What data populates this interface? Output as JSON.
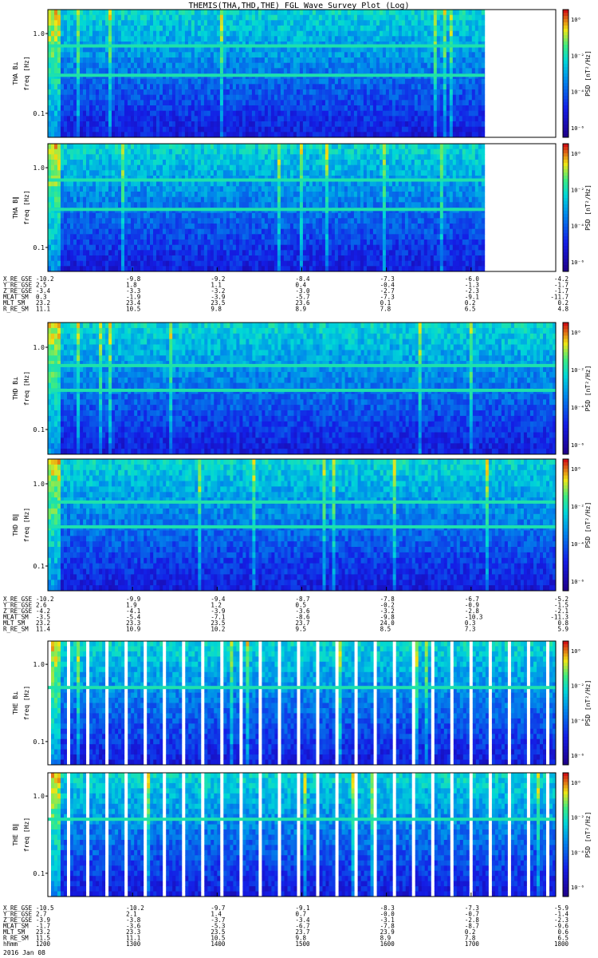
{
  "title": "THEMIS(THA,THD,THE) FGL Wave Survey Plot (Log)",
  "date_label": "2016 Jan 08",
  "colorbar": {
    "label": "PSD [nT²/Hz]",
    "ticks": [
      "10⁰",
      "10⁻²",
      "10⁻⁴",
      "10⁻⁶"
    ]
  },
  "colors": {
    "low": "#1e00a0",
    "mid": "#00c8c8",
    "high": "#d01010",
    "gap": "#ffffff"
  },
  "chart_data": [
    {
      "type": "heatmap",
      "probe": "THA",
      "panels": [
        {
          "name": "THA B⊥",
          "ylabel": "THA B⊥",
          "yunit": "freq [Hz]",
          "yticks": [
            "1.0",
            "0.1"
          ],
          "ylim": [
            0.05,
            2.0
          ]
        },
        {
          "name": "THA B∥",
          "ylabel": "THA B∥",
          "yunit": "freq [Hz]",
          "yticks": [
            "1.0",
            "0.1"
          ],
          "ylim": [
            0.05,
            2.0
          ]
        }
      ],
      "data_end_fraction": 0.86,
      "bright_bands_hz": [
        0.7,
        0.3
      ],
      "ephemeris": [
        {
          "label": "X_RE_GSE",
          "values": [
            "-10.2",
            "-9.8",
            "-9.2",
            "-8.4",
            "-7.3",
            "-6.0",
            "-4.2"
          ]
        },
        {
          "label": "Y_RE_GSE",
          "values": [
            "2.5",
            "1.8",
            "1.1",
            "0.4",
            "-0.4",
            "-1.3",
            "-1.7"
          ]
        },
        {
          "label": "Z_RE_GSE",
          "values": [
            "-3.4",
            "-3.3",
            "-3.2",
            "-3.0",
            "-2.7",
            "-2.3",
            "-1.7"
          ]
        },
        {
          "label": "MLAT_SM",
          "values": [
            "0.3",
            "-1.9",
            "-3.9",
            "-5.7",
            "-7.3",
            "-9.1",
            "-11.7"
          ]
        },
        {
          "label": "MLT_SM",
          "values": [
            "23.2",
            "23.4",
            "23.5",
            "23.6",
            "0.1",
            "0.2",
            "0.2"
          ]
        },
        {
          "label": "R_RE_SM",
          "values": [
            "11.1",
            "10.5",
            "9.8",
            "8.9",
            "7.8",
            "6.5",
            "4.8"
          ]
        }
      ]
    },
    {
      "type": "heatmap",
      "probe": "THD",
      "panels": [
        {
          "name": "THD B⊥",
          "ylabel": "THD B⊥",
          "yunit": "freq [Hz]",
          "yticks": [
            "1.0",
            "0.1"
          ],
          "ylim": [
            0.05,
            2.0
          ]
        },
        {
          "name": "THD B∥",
          "ylabel": "THD B∥",
          "yunit": "freq [Hz]",
          "yticks": [
            "1.0",
            "0.1"
          ],
          "ylim": [
            0.05,
            2.0
          ]
        }
      ],
      "data_end_fraction": 1.0,
      "bright_bands_hz": [
        0.3,
        0.6
      ],
      "ephemeris": [
        {
          "label": "X_RE_GSE",
          "values": [
            "-10.2",
            "-9.9",
            "-9.4",
            "-8.7",
            "-7.8",
            "-6.7",
            "-5.2"
          ]
        },
        {
          "label": "Y_RE_GSE",
          "values": [
            "2.6",
            "1.9",
            "1.2",
            "0.5",
            "-0.2",
            "-0.9",
            "-1.5"
          ]
        },
        {
          "label": "Z_RE_GSE",
          "values": [
            "-4.2",
            "-4.1",
            "-3.9",
            "-3.6",
            "-3.2",
            "-2.8",
            "-2.1"
          ]
        },
        {
          "label": "MLAT_SM",
          "values": [
            "-3.5",
            "-5.4",
            "-7.1",
            "-8.6",
            "-9.8",
            "-10.3",
            "-11.3"
          ]
        },
        {
          "label": "MLT_SM",
          "values": [
            "23.2",
            "23.3",
            "23.5",
            "23.7",
            "24.0",
            "0.3",
            "0.8"
          ]
        },
        {
          "label": "R_RE_SM",
          "values": [
            "11.4",
            "10.9",
            "10.2",
            "9.5",
            "8.5",
            "7.3",
            "5.9"
          ]
        }
      ]
    },
    {
      "type": "heatmap",
      "probe": "THE",
      "panels": [
        {
          "name": "THE B⊥",
          "ylabel": "THE B⊥",
          "yunit": "freq [Hz]",
          "yticks": [
            "1.0",
            "0.1"
          ],
          "ylim": [
            0.05,
            2.0
          ]
        },
        {
          "name": "THE B∥",
          "ylabel": "THE B∥",
          "yunit": "freq [Hz]",
          "yticks": [
            "1.0",
            "0.1"
          ],
          "ylim": [
            0.05,
            2.0
          ]
        }
      ],
      "data_end_fraction": 1.0,
      "bright_bands_hz": [
        0.5
      ],
      "ephemeris": [
        {
          "label": "X_RE_GSE",
          "values": [
            "-10.5",
            "-10.2",
            "-9.7",
            "-9.1",
            "-8.3",
            "-7.3",
            "-5.9"
          ]
        },
        {
          "label": "Y_RE_GSE",
          "values": [
            "2.7",
            "2.1",
            "1.4",
            "0.7",
            "-0.0",
            "-0.7",
            "-1.4"
          ]
        },
        {
          "label": "Z_RE_GSE",
          "values": [
            "-3.9",
            "-3.8",
            "-3.7",
            "-3.4",
            "-3.1",
            "-2.8",
            "-2.3"
          ]
        },
        {
          "label": "MLAT_SM",
          "values": [
            "-1.7",
            "-3.6",
            "-5.3",
            "-6.7",
            "-7.8",
            "-8.7",
            "-9.6"
          ]
        },
        {
          "label": "MLT_SM",
          "values": [
            "23.2",
            "23.3",
            "23.5",
            "23.7",
            "23.9",
            "0.2",
            "0.6"
          ]
        },
        {
          "label": "R_RE_SM",
          "values": [
            "11.5",
            "11.1",
            "10.5",
            "9.8",
            "8.9",
            "7.8",
            "6.5"
          ]
        },
        {
          "label": "hhmm",
          "values": [
            "1200",
            "1300",
            "1400",
            "1500",
            "1600",
            "1700",
            "1800"
          ]
        }
      ]
    }
  ]
}
